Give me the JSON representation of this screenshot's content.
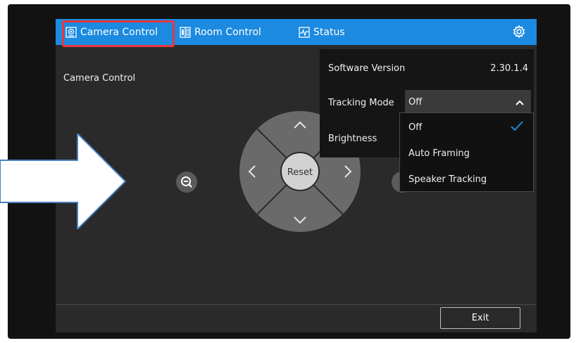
{
  "tabs": [
    {
      "label": "Camera Control",
      "icon": "camera-icon"
    },
    {
      "label": "Room Control",
      "icon": "room-icon"
    },
    {
      "label": "Status",
      "icon": "status-icon"
    }
  ],
  "settings_icon": "gear-icon",
  "content": {
    "title": "Camera Control",
    "reset_label": "Reset",
    "exit_label": "Exit"
  },
  "settings_panel": {
    "software_version_label": "Software Version",
    "software_version_value": "2.30.1.4",
    "tracking_mode_label": "Tracking Mode",
    "tracking_mode_value": "Off",
    "brightness_label": "Brightness",
    "tracking_options": [
      "Off",
      "Auto Framing",
      "Speaker Tracking"
    ]
  },
  "colors": {
    "topbar": "#1b8ae0",
    "highlight": "#e8363f",
    "checkmark": "#1b8ae0",
    "screen_bg": "#2a2a2a"
  }
}
